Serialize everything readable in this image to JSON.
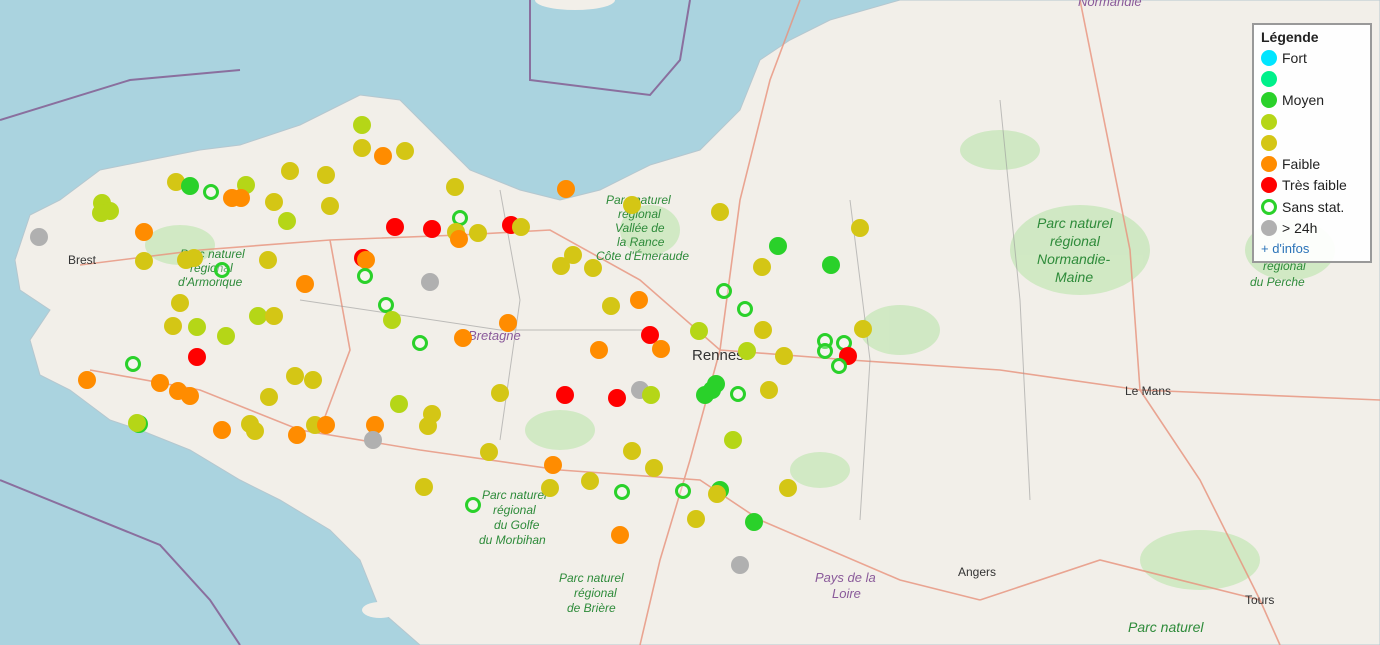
{
  "map": {
    "labels": {
      "brest": "Brest",
      "rennes": "Rennes",
      "le_mans": "Le Mans",
      "angers": "Angers",
      "tours": "Tours",
      "normandie": "Normandie",
      "bretagne": "Bretagne",
      "pays_de_la_loire": [
        "Pays de la",
        "Loire"
      ],
      "park_armorique": [
        "Parc naturel",
        "régional",
        "d'Armorique"
      ],
      "park_rance": [
        "Parc naturel",
        "régional",
        "Vallée de",
        "la Rance",
        "Côte d'Émeraude"
      ],
      "park_normandie_maine": [
        "Parc naturel",
        "régional",
        "Normandie-",
        "Maine"
      ],
      "park_perche": [
        "régional",
        "du Perche"
      ],
      "park_morbihan": [
        "Parc naturel",
        "régional",
        "du Golfe",
        "du Morbihan"
      ],
      "park_briere": [
        "Parc naturel",
        "régional",
        "de Brière"
      ],
      "park_bottom": "Parc naturel"
    }
  },
  "legend": {
    "title": "Légende",
    "items": [
      {
        "label": "Fort",
        "color": "#00e5ff",
        "style": "filled"
      },
      {
        "label": "",
        "color": "#00f08a",
        "style": "filled"
      },
      {
        "label": "Moyen",
        "color": "#2ad12a",
        "style": "filled"
      },
      {
        "label": "",
        "color": "#b5d617",
        "style": "filled"
      },
      {
        "label": "",
        "color": "#d4c615",
        "style": "filled"
      },
      {
        "label": "Faible",
        "color": "#ff8c00",
        "style": "filled"
      },
      {
        "label": "Très faible",
        "color": "#ff0000",
        "style": "filled"
      },
      {
        "label": "Sans stat.",
        "color": "#2ad12a",
        "style": "ring"
      },
      {
        "label": "> 24h",
        "color": "#b0b0b0",
        "style": "filled"
      }
    ],
    "more_link": "+ d'infos"
  }
}
